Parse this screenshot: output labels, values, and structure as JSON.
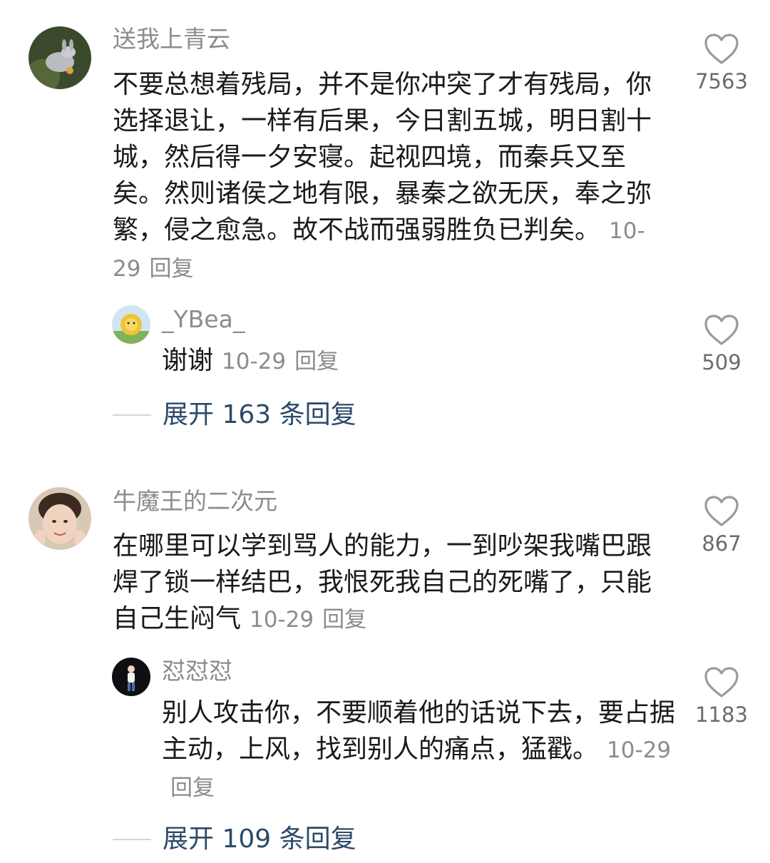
{
  "comments": [
    {
      "username": "送我上青云",
      "text": "不要总想着残局，并不是你冲突了才有残局，你选择退让，一样有后果，今日割五城，明日割十城，然后得一夕安寝。起视四境，而秦兵又至矣。然则诸侯之地有限，暴秦之欲无厌，奉之弥繁，侵之愈急。故不战而强弱胜负已判矣。",
      "date": "10-29",
      "reply_label": "回复",
      "likes": "7563",
      "reply": {
        "username": "_YBea_",
        "text": "谢谢",
        "date": "10-29",
        "reply_label": "回复",
        "likes": "509"
      },
      "expand_label": "展开 163 条回复"
    },
    {
      "username": "牛魔王的二次元",
      "text": "在哪里可以学到骂人的能力，一到吵架我嘴巴跟焊了锁一样结巴，我恨死我自己的死嘴了，只能自己生闷气",
      "date": "10-29",
      "reply_label": "回复",
      "likes": "867",
      "reply": {
        "username": "怼怼怼",
        "text": "别人攻击你，不要顺着他的话说下去，要占据主动，上风，找到别人的痛点，猛戳。",
        "date": "10-29",
        "reply_label": "回复",
        "likes": "1183"
      },
      "expand_label": "展开 109 条回复"
    }
  ],
  "icons": {
    "like": "heart-outline-icon"
  },
  "colors": {
    "username": "#8c8c8c",
    "expand": "#2c4a6a",
    "heart": "#9a9a9a"
  }
}
